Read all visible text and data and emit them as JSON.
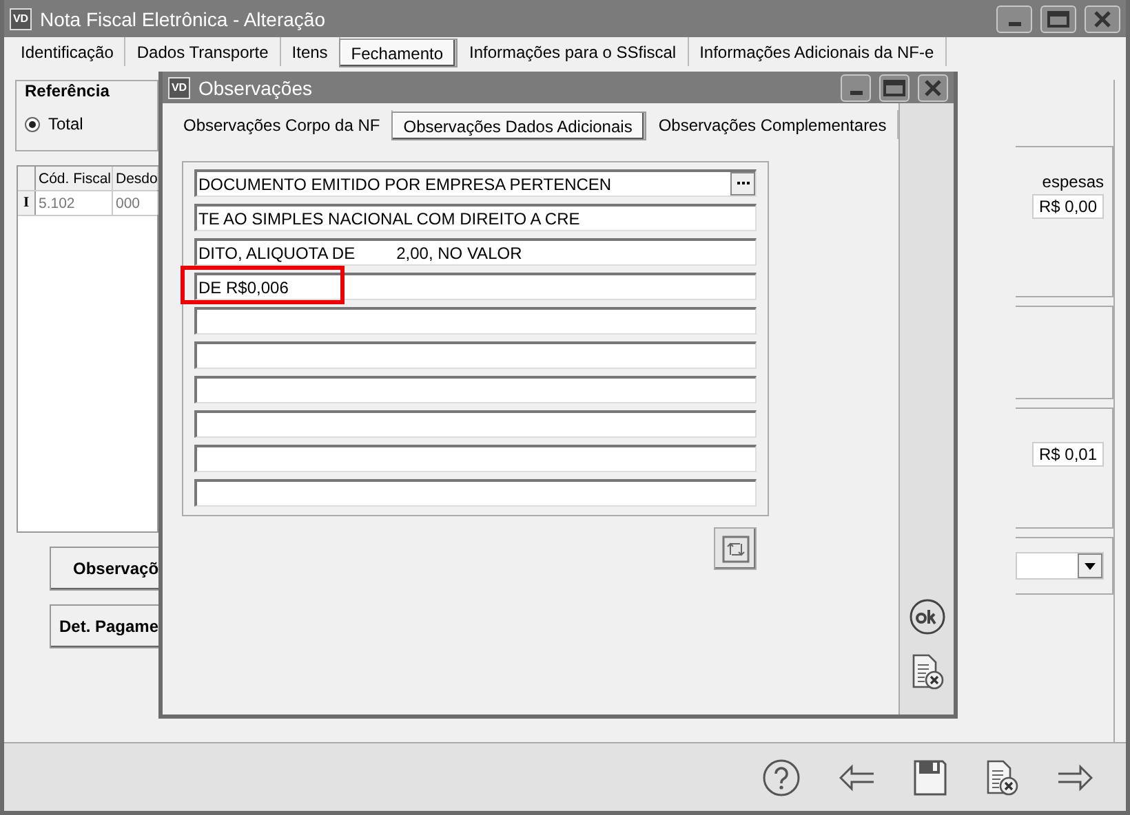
{
  "window": {
    "logo": "VD",
    "title": "Nota Fiscal Eletrônica - Alteração"
  },
  "tabs": [
    {
      "label": "Identificação",
      "selected": false
    },
    {
      "label": "Dados Transporte",
      "selected": false
    },
    {
      "label": "Itens",
      "selected": false
    },
    {
      "label": "Fechamento",
      "selected": true
    },
    {
      "label": "Informações para o SSfiscal",
      "selected": false
    },
    {
      "label": "Informações Adicionais da NF-e",
      "selected": false
    }
  ],
  "reference": {
    "title": "Referência",
    "options": [
      {
        "label": "Total",
        "selected": true
      }
    ]
  },
  "grid": {
    "columns": [
      "Cód. Fiscal",
      "Desdo"
    ],
    "rows": [
      {
        "marker": "I",
        "cells": [
          "5.102",
          "000"
        ]
      }
    ]
  },
  "buttons": [
    "Observaçõ",
    "Det. Pagame"
  ],
  "right_panel": {
    "label": "espesas",
    "value_1": "R$ 0,00",
    "value_2": "R$ 0,01"
  },
  "dialog": {
    "logo": "VD",
    "title": "Observações",
    "tabs": [
      {
        "label": "Observações Corpo da NF",
        "selected": false
      },
      {
        "label": "Observações Dados Adicionais",
        "selected": true
      },
      {
        "label": "Observações Complementares",
        "selected": false
      }
    ],
    "lines": [
      {
        "kind": "filled",
        "value": "DOCUMENTO EMITIDO POR EMPRESA PERTENCEN",
        "highlighted": false
      },
      {
        "kind": "filled",
        "value": "TE AO SIMPLES NACIONAL COM DIREITO A CRE",
        "highlighted": false
      },
      {
        "kind": "filled",
        "value": "DITO, ALIQUOTA DE         2,00, NO VALOR",
        "highlighted": false
      },
      {
        "kind": "filled",
        "value": "DE R$0,006",
        "highlighted": true
      },
      {
        "kind": "blank",
        "highlighted": false
      },
      {
        "kind": "blank",
        "highlighted": false
      },
      {
        "kind": "blank",
        "highlighted": false
      },
      {
        "kind": "blank",
        "highlighted": false
      },
      {
        "kind": "blank",
        "highlighted": false
      },
      {
        "kind": "blank",
        "highlighted": false
      }
    ]
  }
}
